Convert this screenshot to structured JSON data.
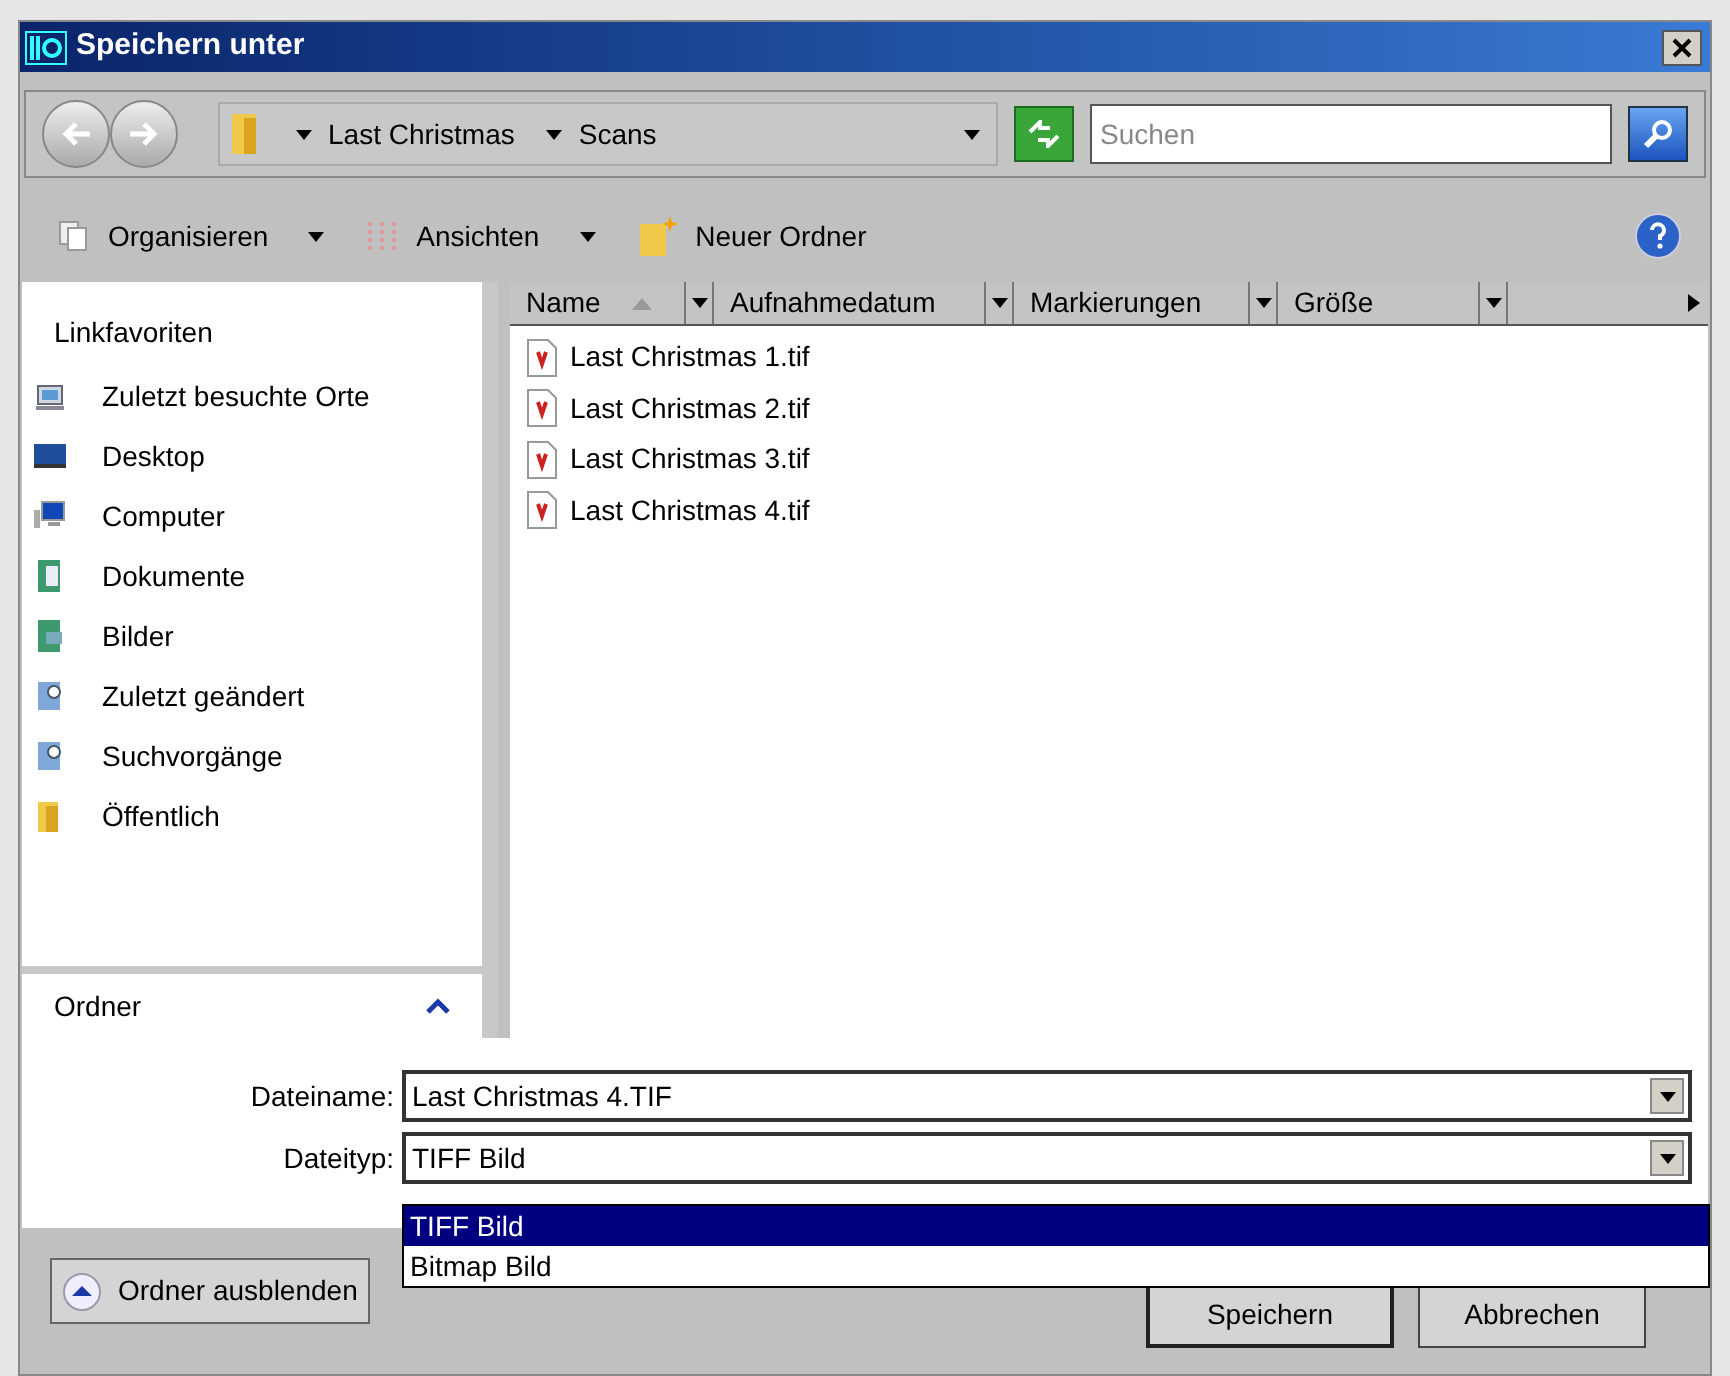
{
  "window": {
    "title": "Speichern unter"
  },
  "address": {
    "crumbs": [
      "Last Christmas",
      "Scans"
    ]
  },
  "search": {
    "placeholder": "Suchen"
  },
  "toolbar": [
    {
      "label": "Organisieren",
      "kind": "menu"
    },
    {
      "label": "Ansichten",
      "kind": "menu"
    },
    {
      "label": "Neuer Ordner",
      "kind": "action"
    }
  ],
  "sidebar": {
    "heading": "Linkfavoriten",
    "items": [
      {
        "label": "Zuletzt besuchte Orte",
        "kind": "recent"
      },
      {
        "label": "Desktop",
        "kind": "desktop"
      },
      {
        "label": "Computer",
        "kind": "computer"
      },
      {
        "label": "Dokumente",
        "kind": "docs"
      },
      {
        "label": "Bilder",
        "kind": "pictures"
      },
      {
        "label": "Zuletzt geändert",
        "kind": "search"
      },
      {
        "label": "Suchvorgänge",
        "kind": "search"
      },
      {
        "label": "Öffentlich",
        "kind": "folder"
      }
    ],
    "folders": {
      "label": "Ordner",
      "expanded": false
    }
  },
  "table": {
    "columns": [
      {
        "label": "Name",
        "sorted": true
      },
      {
        "label": "Aufnahmedatum",
        "sorted": false
      },
      {
        "label": "Markierungen",
        "sorted": false
      },
      {
        "label": "Größe",
        "sorted": false
      }
    ],
    "rows": [
      "Last Christmas 1.tif",
      "Last Christmas 2.tif",
      "Last Christmas 3.tif",
      "Last Christmas 4.tif"
    ]
  },
  "form": {
    "filename": {
      "label": "Dateiname:",
      "value": "Last Christmas 4.TIF"
    },
    "filetype": {
      "label": "Dateityp:",
      "value": "TIFF Bild",
      "options": [
        {
          "label": "TIFF Bild",
          "selected": true
        },
        {
          "label": "Bitmap Bild",
          "selected": false
        }
      ]
    }
  },
  "buttons": {
    "toggle": "Ordner ausblenden",
    "save": "Speichern",
    "cancel": "Abbrechen"
  }
}
